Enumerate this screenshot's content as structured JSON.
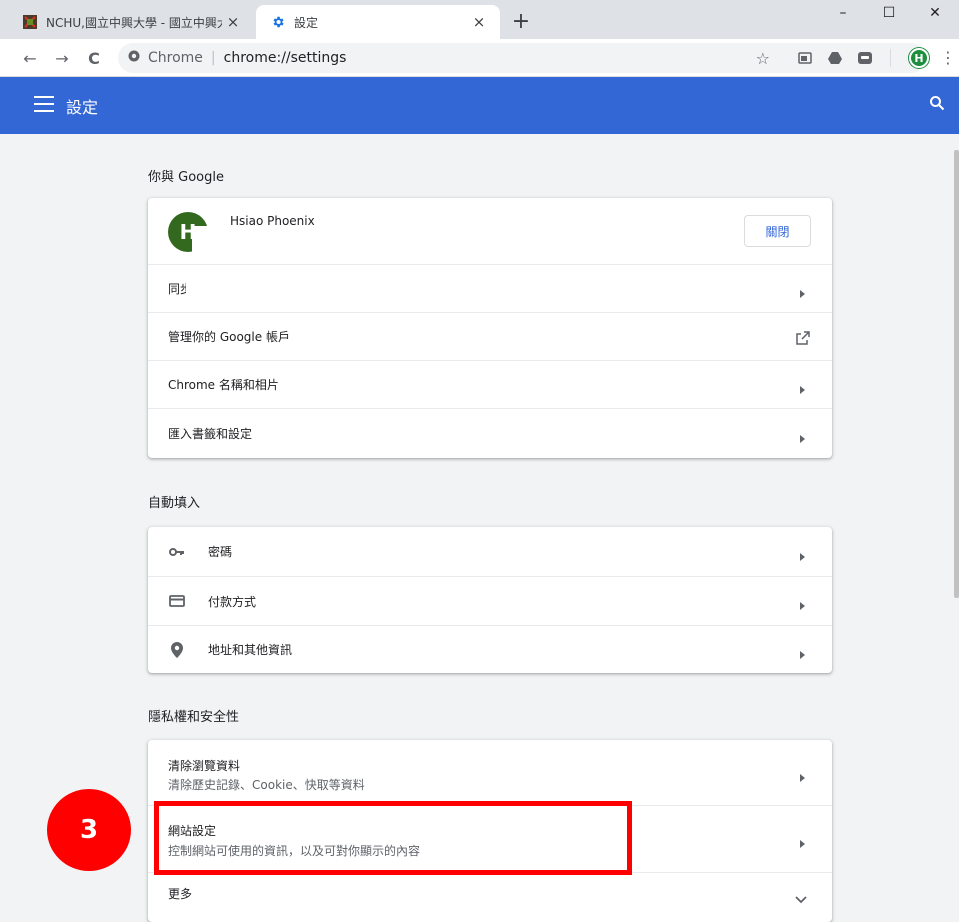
{
  "tabs": [
    {
      "title": "NCHU,國立中興大學 - 國立中興大",
      "close": "×"
    },
    {
      "title": "設定",
      "close": "×"
    }
  ],
  "new_tab": "+",
  "window_controls": {
    "minimize": "–",
    "maximize": "☐",
    "close": "✕"
  },
  "toolbar": {
    "back": "←",
    "forward": "→",
    "reload": "C",
    "omnibox_chrome": "Chrome",
    "omnibox_separator": "|",
    "omnibox_url": "chrome://settings",
    "star": "☆",
    "profile_initial": "H",
    "menu": "⋮"
  },
  "header": {
    "title": "設定"
  },
  "sections": {
    "you_and_google": {
      "title": "你與 Google",
      "account_initial": "H",
      "account_name": "Hsiao Phoenix",
      "sync_off_button": "關閉",
      "rows": [
        {
          "label": "同步"
        },
        {
          "label": "管理你的 Google 帳戶"
        },
        {
          "label": "Chrome 名稱和相片"
        },
        {
          "label": "匯入書籤和設定"
        }
      ]
    },
    "autofill": {
      "title": "自動填入",
      "rows": [
        {
          "label": "密碼",
          "icon": "key-icon"
        },
        {
          "label": "付款方式",
          "icon": "credit-card-icon"
        },
        {
          "label": "地址和其他資訊",
          "icon": "location-pin-icon"
        }
      ]
    },
    "privacy": {
      "title": "隱私權和安全性",
      "rows": [
        {
          "label": "清除瀏覽資料",
          "sub": "清除歷史記錄、Cookie、快取等資料"
        },
        {
          "label": "網站設定",
          "sub": "控制網站可使用的資訊，以及可對你顯示的內容"
        },
        {
          "label": "更多"
        }
      ]
    }
  },
  "annotation": {
    "step_number": "3",
    "color": "#ff0000"
  },
  "colors": {
    "header_blue": "#3367d6",
    "background": "#f1f3f4"
  }
}
